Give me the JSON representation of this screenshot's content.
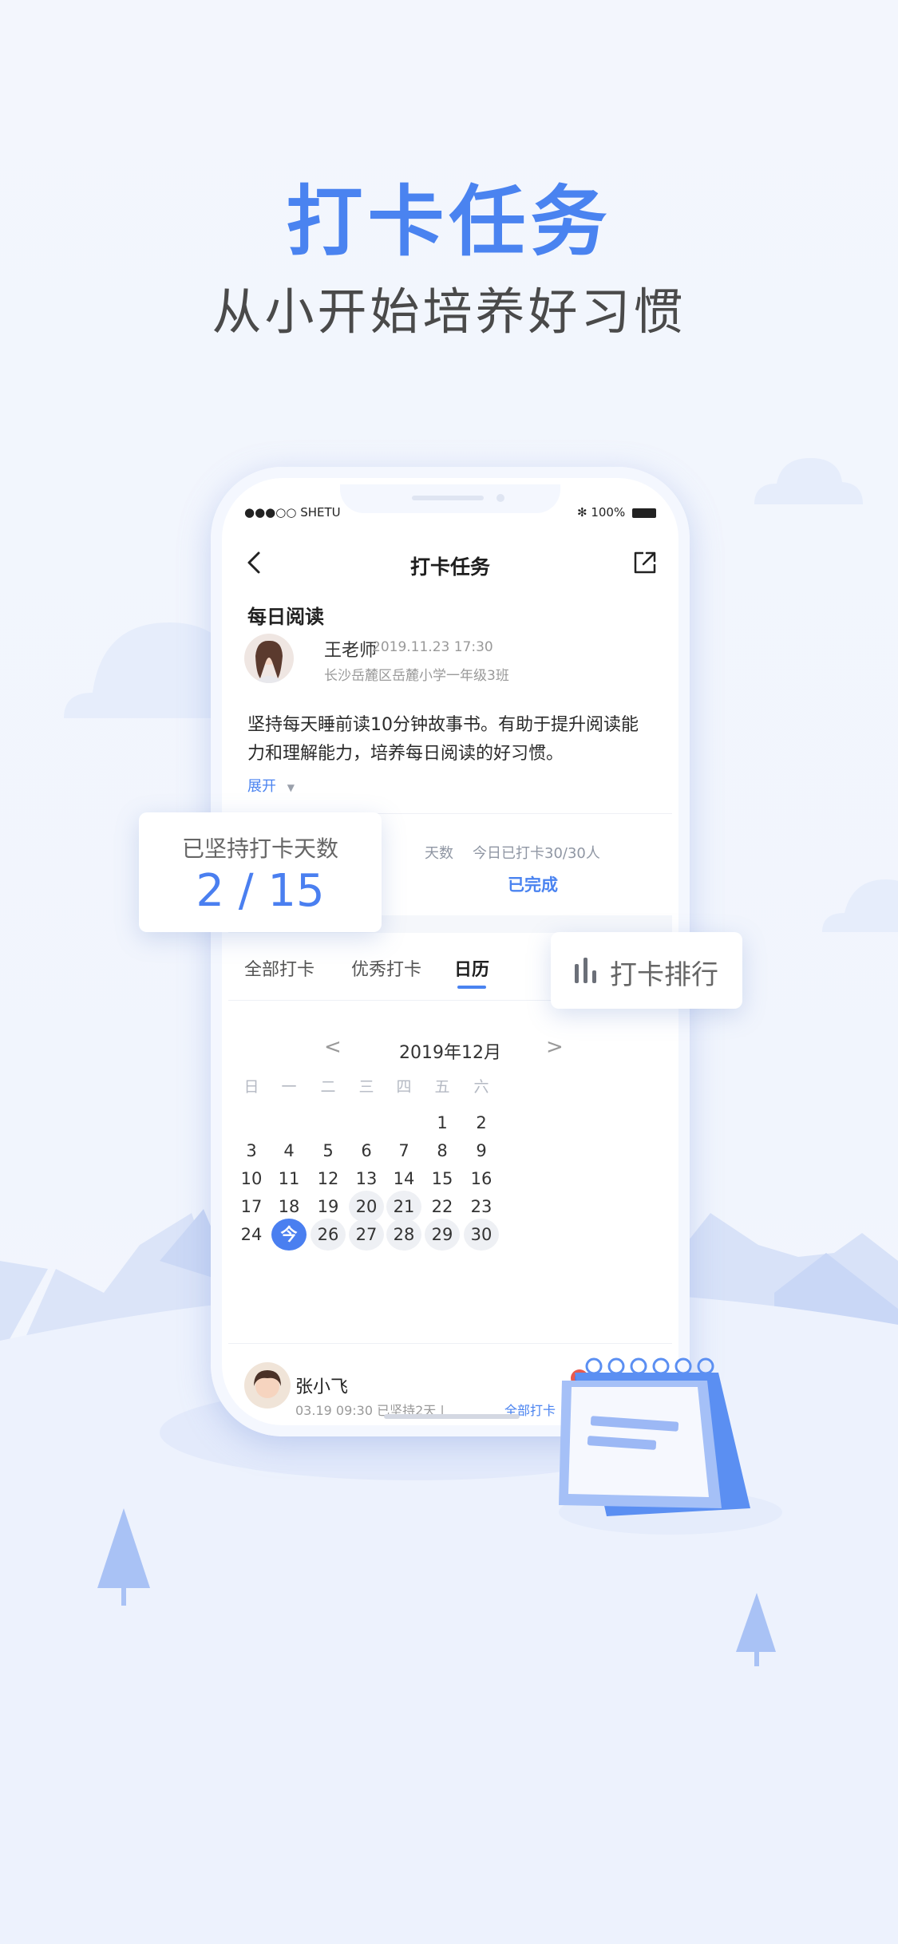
{
  "hero": {
    "title": "打卡任务",
    "subtitle": "从小开始培养好习惯"
  },
  "status_bar": {
    "carrier": "●●●○○ SHETU",
    "bluetooth": "✻",
    "battery": "100%"
  },
  "nav": {
    "title": "打卡任务"
  },
  "task": {
    "name": "每日阅读",
    "teacher": {
      "name": "王老师",
      "time": "2019.11.23 17:30",
      "school": "长沙岳麓区岳麓小学一年级3班"
    },
    "description": "坚持每天睡前读10分钟故事书。有助于提升阅读能力和理解能力，培养每日阅读的好习惯。",
    "expand_label": "展开"
  },
  "stats": {
    "streak_label_partial": "天数",
    "today_label": "今日已打卡30/30人",
    "today_status": "已完成"
  },
  "streak_card": {
    "label": "已坚持打卡天数",
    "value": "2 / 15"
  },
  "rank_card": {
    "label": "打卡排行"
  },
  "tabs": [
    {
      "label": "全部打卡",
      "active": false
    },
    {
      "label": "优秀打卡",
      "active": false
    },
    {
      "label": "日历",
      "active": true
    }
  ],
  "calendar": {
    "month": "2019年12月",
    "prev": "<",
    "next": ">",
    "weekdays": [
      "日",
      "一",
      "二",
      "三",
      "四",
      "五",
      "六"
    ],
    "rows": [
      [
        "",
        "",
        "",
        "",
        "",
        "1",
        "2"
      ],
      [
        "3",
        "4",
        "5",
        "6",
        "7",
        "8",
        "9"
      ],
      [
        "10",
        "11",
        "12",
        "13",
        "14",
        "15",
        "16"
      ],
      [
        "17",
        "18",
        "19",
        "20",
        "21",
        "22",
        "23"
      ],
      [
        "24",
        "今",
        "26",
        "27",
        "28",
        "29",
        "30"
      ]
    ],
    "marked": [
      "20",
      "21",
      "26",
      "27",
      "28",
      "29",
      "30"
    ],
    "today": "今"
  },
  "bottom_entry": {
    "name": "张小飞",
    "meta": "03.19 09:30  已坚持2天 |",
    "link": "全部打卡"
  },
  "colors": {
    "accent": "#4a83f0",
    "background": "#f2f5fd"
  }
}
